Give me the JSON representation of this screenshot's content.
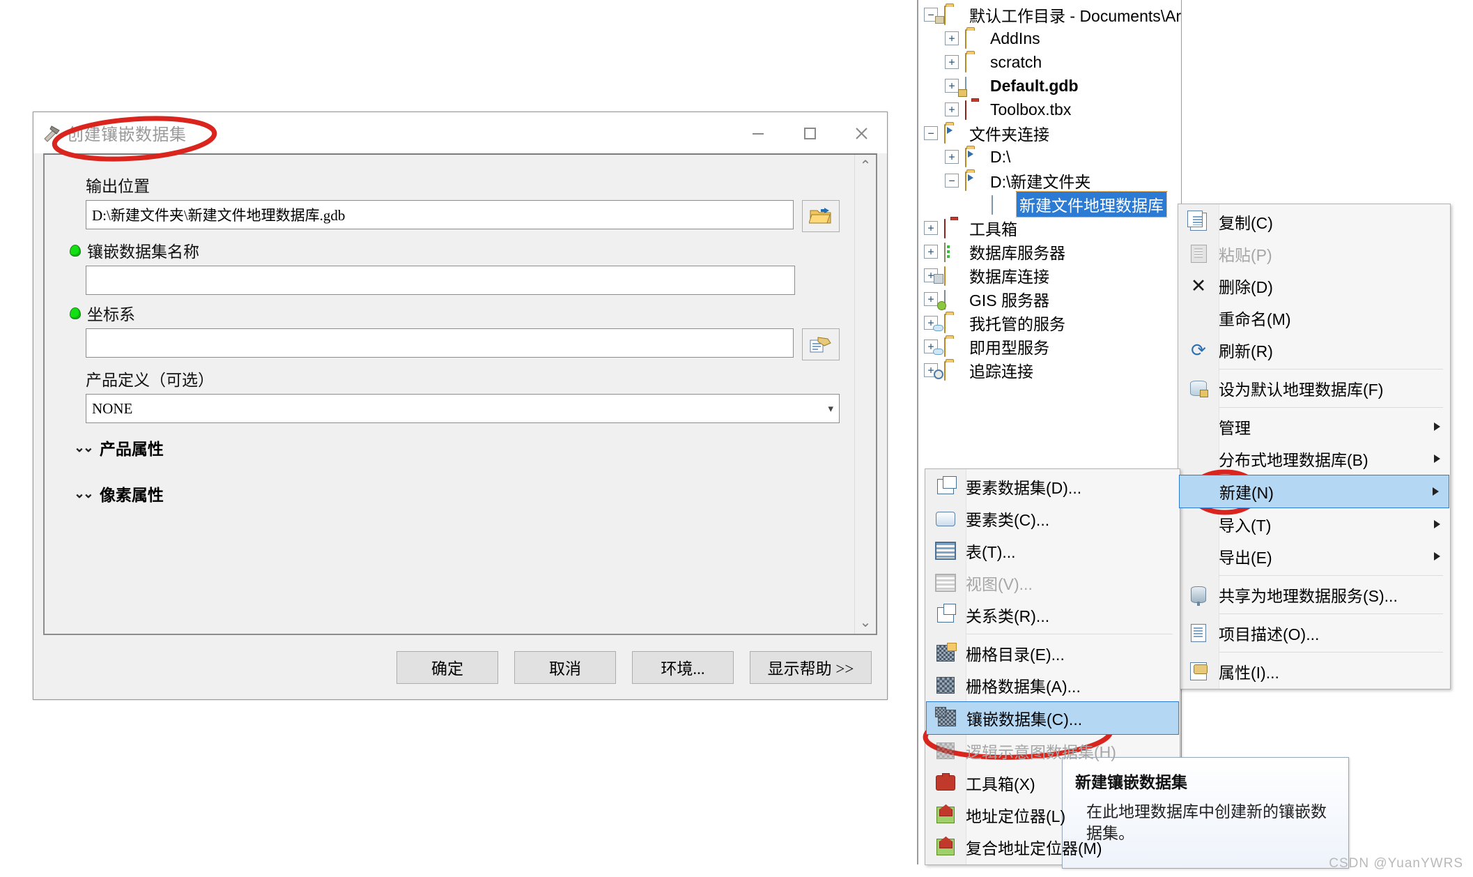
{
  "dialog": {
    "title": "创建镶嵌数据集",
    "icon": "hammer-icon",
    "window_buttons": {
      "minimize": "—",
      "maximize": "▢",
      "close": "✕"
    },
    "fields": {
      "output_location": {
        "label": "输出位置",
        "value": "D:\\新建文件夹\\新建文件地理数据库.gdb",
        "required": false,
        "browse_icon": "folder-open-icon"
      },
      "mosaic_name": {
        "label": "镶嵌数据集名称",
        "value": "",
        "required": true
      },
      "coordinate_system": {
        "label": "坐标系",
        "value": "",
        "required": true,
        "browse_icon": "spatial-reference-icon"
      },
      "product_definition": {
        "label": "产品定义（可选）",
        "value": "NONE",
        "required": false,
        "caret": "▾"
      }
    },
    "sections": [
      {
        "label": "产品属性",
        "chevron": "⌄⌄"
      },
      {
        "label": "像素属性",
        "chevron": "⌄⌄"
      }
    ],
    "scrollbar": {
      "up": "⌃",
      "down": "⌄"
    },
    "buttons": [
      {
        "label": "确定",
        "width": "w1"
      },
      {
        "label": "取消",
        "width": "w1"
      },
      {
        "label": "环境...",
        "width": "w1"
      },
      {
        "label": "显示帮助 >>",
        "width": "w2"
      }
    ]
  },
  "catalog": {
    "rows": [
      {
        "indent": 0,
        "expander": "−",
        "icon": "folder-home-icon",
        "label": "默认工作目录 - Documents\\ArcGIS",
        "bold": false,
        "selected": false
      },
      {
        "indent": 1,
        "expander": "+",
        "icon": "folder-icon",
        "label": "AddIns",
        "bold": false,
        "selected": false
      },
      {
        "indent": 1,
        "expander": "+",
        "icon": "folder-icon",
        "label": "scratch",
        "bold": false,
        "selected": false
      },
      {
        "indent": 1,
        "expander": "+",
        "icon": "geodatabase-home-icon",
        "label": "Default.gdb",
        "bold": true,
        "selected": false
      },
      {
        "indent": 1,
        "expander": "+",
        "icon": "toolbox-icon",
        "label": "Toolbox.tbx",
        "bold": false,
        "selected": false
      },
      {
        "indent": 0,
        "expander": "−",
        "icon": "folder-connection-icon",
        "label": "文件夹连接",
        "bold": false,
        "selected": false
      },
      {
        "indent": 1,
        "expander": "+",
        "icon": "folder-connection-icon",
        "label": "D:\\",
        "bold": false,
        "selected": false
      },
      {
        "indent": 1,
        "expander": "−",
        "icon": "folder-connection-icon",
        "label": "D:\\新建文件夹",
        "bold": false,
        "selected": false
      },
      {
        "indent": 2,
        "expander": "",
        "icon": "geodatabase-icon",
        "label": "新建文件地理数据库",
        "bold": false,
        "selected": true
      },
      {
        "indent": 0,
        "expander": "+",
        "icon": "toolbox-folder-icon",
        "label": "工具箱",
        "bold": false,
        "selected": false
      },
      {
        "indent": 0,
        "expander": "+",
        "icon": "database-server-icon",
        "label": "数据库服务器",
        "bold": false,
        "selected": false
      },
      {
        "indent": 0,
        "expander": "+",
        "icon": "database-connection-icon",
        "label": "数据库连接",
        "bold": false,
        "selected": false
      },
      {
        "indent": 0,
        "expander": "+",
        "icon": "gis-server-icon",
        "label": "GIS 服务器",
        "bold": false,
        "selected": false
      },
      {
        "indent": 0,
        "expander": "+",
        "icon": "cloud-folder-icon",
        "label": "我托管的服务",
        "bold": false,
        "selected": false
      },
      {
        "indent": 0,
        "expander": "+",
        "icon": "cloud-folder-icon",
        "label": "即用型服务",
        "bold": false,
        "selected": false
      },
      {
        "indent": 0,
        "expander": "+",
        "icon": "tracking-folder-icon",
        "label": "追踪连接",
        "bold": false,
        "selected": false
      }
    ]
  },
  "context_menu": {
    "items": [
      {
        "label": "复制(C)",
        "icon": "copy-icon",
        "disabled": false,
        "submenu": false,
        "selected": false,
        "sep_after": false
      },
      {
        "label": "粘贴(P)",
        "icon": "paste-icon",
        "disabled": true,
        "submenu": false,
        "selected": false,
        "sep_after": false
      },
      {
        "label": "删除(D)",
        "icon": "delete-icon",
        "disabled": false,
        "submenu": false,
        "selected": false,
        "sep_after": false
      },
      {
        "label": "重命名(M)",
        "icon": "",
        "disabled": false,
        "submenu": false,
        "selected": false,
        "sep_after": false
      },
      {
        "label": "刷新(R)",
        "icon": "refresh-icon",
        "disabled": false,
        "submenu": false,
        "selected": false,
        "sep_after": true
      },
      {
        "label": "设为默认地理数据库(F)",
        "icon": "default-gdb-icon",
        "disabled": false,
        "submenu": false,
        "selected": false,
        "sep_after": true
      },
      {
        "label": "管理",
        "icon": "",
        "disabled": false,
        "submenu": true,
        "selected": false,
        "sep_after": false
      },
      {
        "label": "分布式地理数据库(B)",
        "icon": "",
        "disabled": false,
        "submenu": true,
        "selected": false,
        "sep_after": false
      },
      {
        "label": "新建(N)",
        "icon": "",
        "disabled": false,
        "submenu": true,
        "selected": true,
        "sep_after": false
      },
      {
        "label": "导入(T)",
        "icon": "",
        "disabled": false,
        "submenu": true,
        "selected": false,
        "sep_after": false
      },
      {
        "label": "导出(E)",
        "icon": "",
        "disabled": false,
        "submenu": true,
        "selected": false,
        "sep_after": true
      },
      {
        "label": "共享为地理数据服务(S)...",
        "icon": "share-icon",
        "disabled": false,
        "submenu": false,
        "selected": false,
        "sep_after": true
      },
      {
        "label": "项目描述(O)...",
        "icon": "document-icon",
        "disabled": false,
        "submenu": false,
        "selected": false,
        "sep_after": true
      },
      {
        "label": "属性(I)...",
        "icon": "properties-icon",
        "disabled": false,
        "submenu": false,
        "selected": false,
        "sep_after": false
      }
    ]
  },
  "new_submenu": {
    "items": [
      {
        "label": "要素数据集(D)...",
        "icon": "feature-dataset-icon",
        "disabled": false,
        "selected": false,
        "sep_after": false
      },
      {
        "label": "要素类(C)...",
        "icon": "feature-class-icon",
        "disabled": false,
        "selected": false,
        "sep_after": false
      },
      {
        "label": "表(T)...",
        "icon": "table-icon",
        "disabled": false,
        "selected": false,
        "sep_after": false
      },
      {
        "label": "视图(V)...",
        "icon": "view-icon",
        "disabled": true,
        "selected": false,
        "sep_after": false
      },
      {
        "label": "关系类(R)...",
        "icon": "relationship-class-icon",
        "disabled": false,
        "selected": false,
        "sep_after": true
      },
      {
        "label": "栅格目录(E)...",
        "icon": "raster-catalog-icon",
        "disabled": false,
        "selected": false,
        "sep_after": false
      },
      {
        "label": "栅格数据集(A)...",
        "icon": "raster-dataset-icon",
        "disabled": false,
        "selected": false,
        "sep_after": false
      },
      {
        "label": "镶嵌数据集(C)...",
        "icon": "mosaic-dataset-icon",
        "disabled": false,
        "selected": true,
        "sep_after": false
      },
      {
        "label": "逻辑示意图数据集(H)",
        "icon": "schematic-dataset-icon",
        "disabled": true,
        "selected": false,
        "sep_after": false
      },
      {
        "label": "工具箱(X)",
        "icon": "toolbox-icon",
        "disabled": false,
        "selected": false,
        "sep_after": false
      },
      {
        "label": "地址定位器(L)",
        "icon": "address-locator-icon",
        "disabled": false,
        "selected": false,
        "sep_after": false
      },
      {
        "label": "复合地址定位器(M)",
        "icon": "address-locator-icon",
        "disabled": false,
        "selected": false,
        "sep_after": false
      }
    ]
  },
  "tooltip": {
    "title": "新建镶嵌数据集",
    "body": "在此地理数据库中创建新的镶嵌数据集。"
  },
  "watermark": {
    "text": "CSDN @YuanYWRS"
  },
  "annotations": {
    "color": "#d9251d",
    "marks": [
      {
        "name": "title-circle",
        "target": "创建镶嵌数据集"
      },
      {
        "name": "new-menu-circle",
        "target": "新建(N)"
      },
      {
        "name": "mosaic-dataset-circle",
        "target": "镶嵌数据集(C)..."
      }
    ]
  }
}
